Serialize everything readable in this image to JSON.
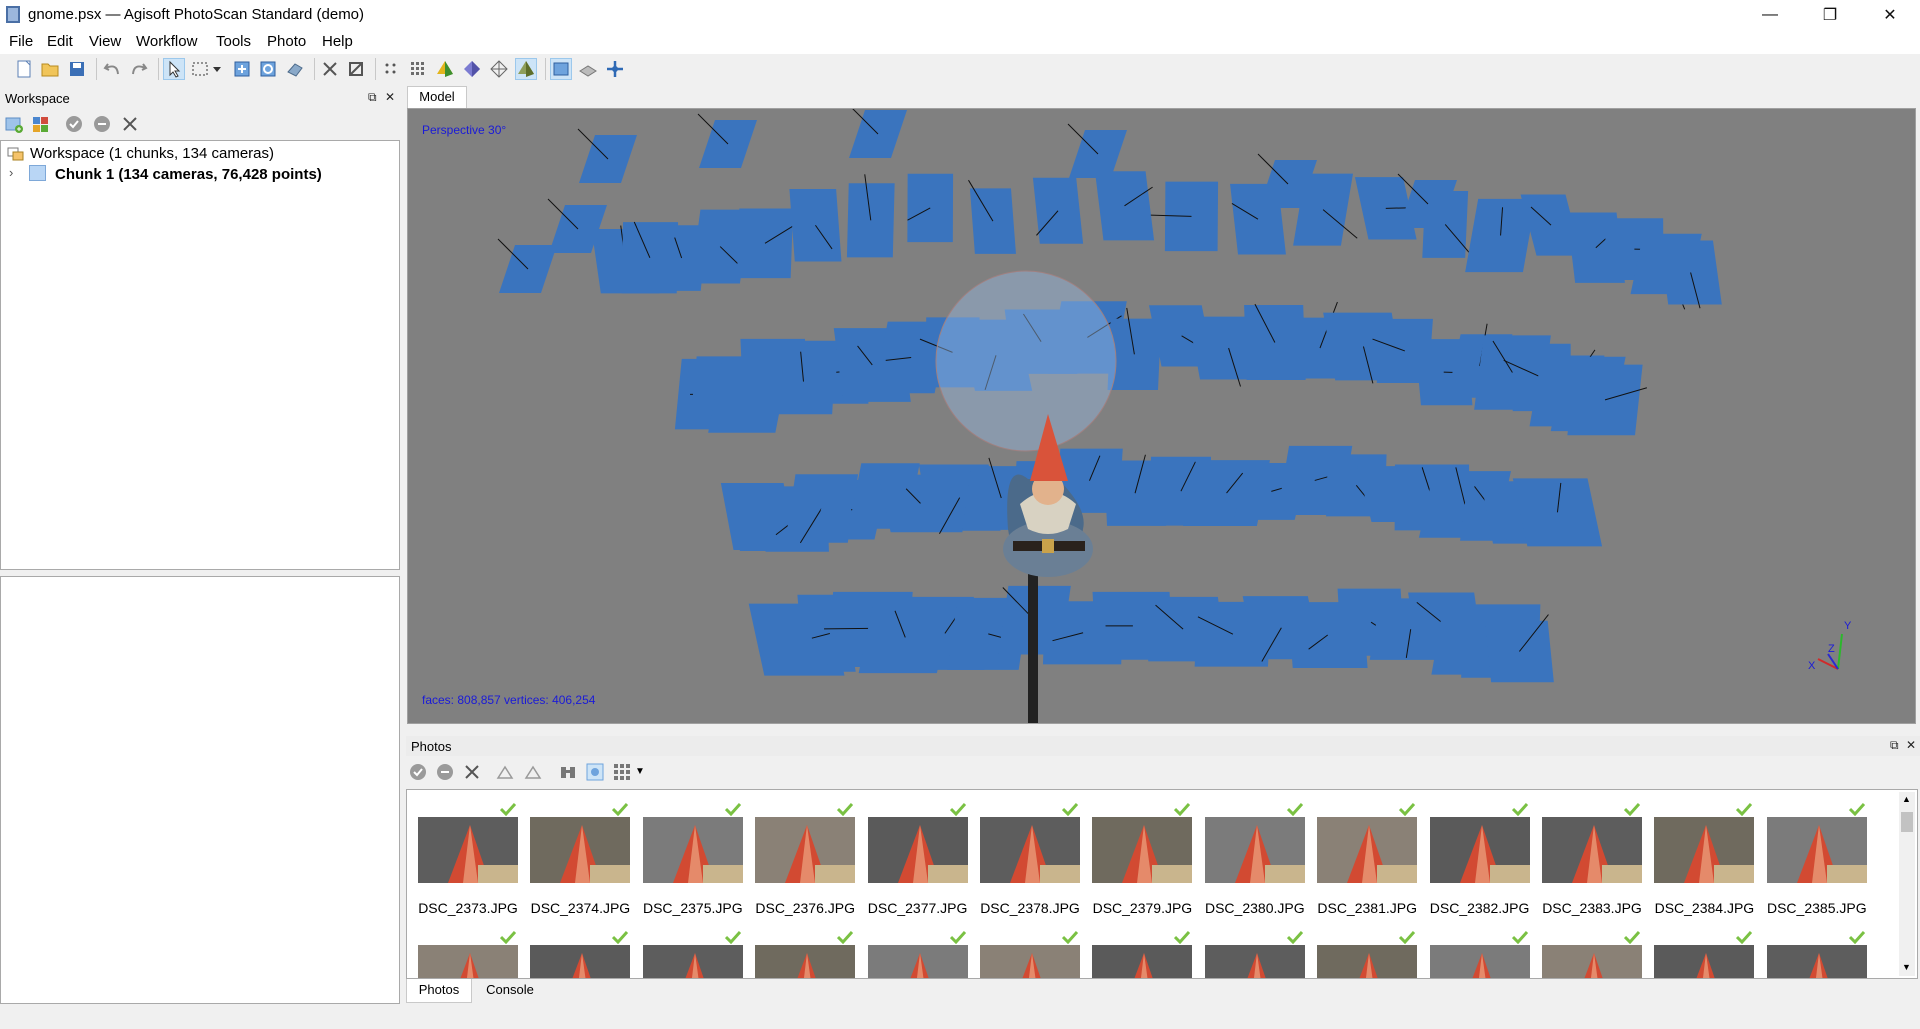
{
  "window": {
    "title": "gnome.psx — Agisoft PhotoScan Standard (demo)",
    "minimize": "—",
    "restore": "❐",
    "close": "✕"
  },
  "menu": [
    "File",
    "Edit",
    "View",
    "Workflow",
    "Tools",
    "Photo",
    "Help"
  ],
  "toolbar_icons": [
    "new-icon",
    "open-icon",
    "save-icon",
    "undo-icon",
    "redo-icon",
    "select-icon",
    "rectangle-selection-icon",
    "dropdown-icon",
    "resize-region-icon",
    "rotate-region-icon",
    "rotate-object-icon",
    "delete-selection-icon",
    "crop-icon",
    "point-cloud-icon",
    "dense-cloud-icon",
    "shaded-model-icon",
    "solid-model-icon",
    "wireframe-icon",
    "textured-model-icon",
    "show-cameras-icon",
    "show-region-icon",
    "navigation-icon"
  ],
  "workspace": {
    "header": "Workspace",
    "root_label": "Workspace (1 chunks, 134 cameras)",
    "chunk_label": "Chunk 1 (134 cameras, 76,428 points)"
  },
  "model": {
    "tab": "Model",
    "projection": "Perspective 30°",
    "stats": "faces: 808,857 vertices: 406,254",
    "axes": {
      "x": "X",
      "y": "Y",
      "z": "Z"
    }
  },
  "colors": {
    "viewport_bg": "#808080",
    "camera_plane": "#3a74be",
    "overlay_text": "#1a1ad8",
    "check_green": "#7ac143"
  },
  "photos": {
    "header": "Photos",
    "items": [
      "DSC_2373.JPG",
      "DSC_2374.JPG",
      "DSC_2375.JPG",
      "DSC_2376.JPG",
      "DSC_2377.JPG",
      "DSC_2378.JPG",
      "DSC_2379.JPG",
      "DSC_2380.JPG",
      "DSC_2381.JPG",
      "DSC_2382.JPG",
      "DSC_2383.JPG",
      "DSC_2384.JPG",
      "DSC_2385.JPG"
    ],
    "second_row_count": 13
  },
  "bottom_tabs": [
    "Photos",
    "Console"
  ]
}
